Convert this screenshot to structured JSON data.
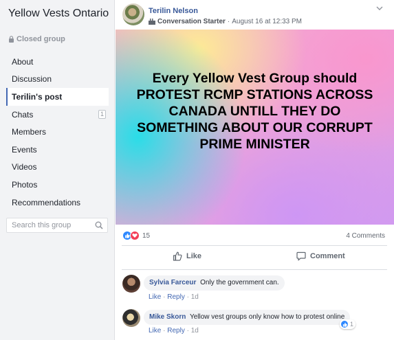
{
  "group": {
    "title": "Yellow Vests Ontario",
    "privacy": "Closed group"
  },
  "nav": {
    "items": [
      {
        "label": "About"
      },
      {
        "label": "Discussion"
      },
      {
        "label": "Terilin's post",
        "active": true
      },
      {
        "label": "Chats",
        "badge": "1"
      },
      {
        "label": "Members"
      },
      {
        "label": "Events"
      },
      {
        "label": "Videos"
      },
      {
        "label": "Photos"
      },
      {
        "label": "Recommendations"
      }
    ]
  },
  "search": {
    "placeholder": "Search this group"
  },
  "post": {
    "author": "Terilin Nelson",
    "role": "Conversation Starter",
    "date": "August 16 at 12:33 PM",
    "image_text": "Every Yellow Vest Group should PROTEST RCMP STATIONS ACROSS CANADA UNTILL THEY DO SOMETHING ABOUT OUR CORRUPT PRIME MINISTER",
    "reaction_count": "15",
    "comments_count": "4 Comments",
    "like_label": "Like",
    "comment_label": "Comment"
  },
  "comments": [
    {
      "author": "Sylvia Farceur",
      "text": "Only the government can.",
      "like": "Like",
      "reply": "Reply",
      "time": "1d"
    },
    {
      "author": "Mike Skorn",
      "text": "Yellow vest groups only know how to protest online",
      "like": "Like",
      "reply": "Reply",
      "time": "1d",
      "reaction_count": "1"
    }
  ],
  "colors": {
    "link_blue": "#385898",
    "accent": "#4267b2",
    "like_blue": "#2d88ff",
    "love_red": "#f33e58"
  }
}
